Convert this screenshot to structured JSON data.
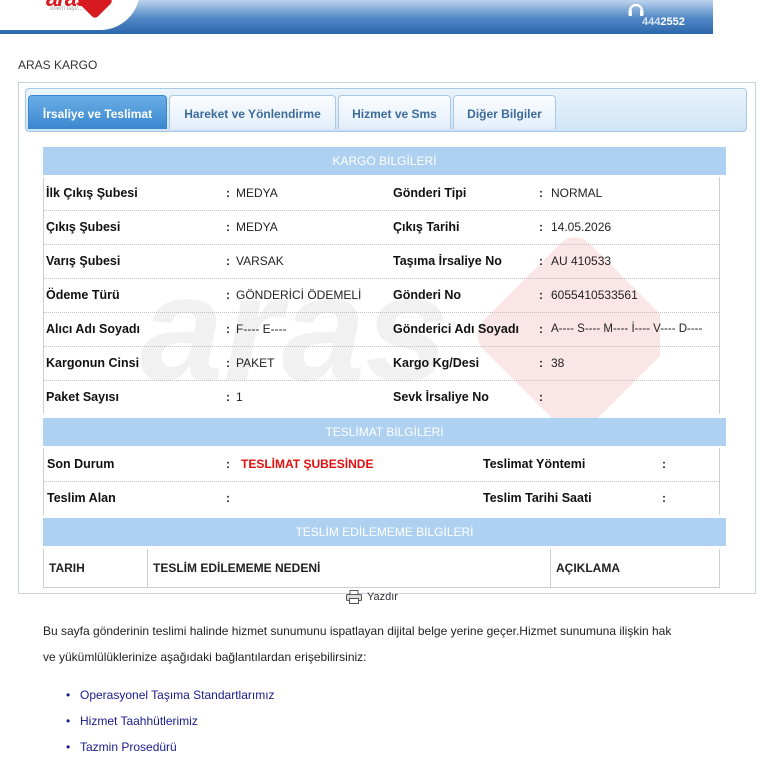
{
  "header": {
    "logo_text": "aras",
    "logo_tagline": "önem taşır...",
    "phone_prefix": "444",
    "phone_number": "2552"
  },
  "brand_label": "ARAS KARGO",
  "tabs": [
    {
      "label": "İrsaliye ve Teslimat",
      "active": true
    },
    {
      "label": "Hareket ve Yönlendirme",
      "active": false
    },
    {
      "label": "Hizmet ve Sms",
      "active": false
    },
    {
      "label": "Diğer Bilgiler",
      "active": false
    }
  ],
  "kargo": {
    "title": "KARGO BİLGİLERİ",
    "rows": [
      {
        "l1": "İlk Çıkış Şubesi",
        "v1": "MEDYA",
        "l2": "Gönderi Tipi",
        "v2": "NORMAL"
      },
      {
        "l1": "Çıkış Şubesi",
        "v1": "MEDYA",
        "l2": "Çıkış Tarihi",
        "v2": "14.05.2026"
      },
      {
        "l1": "Varış Şubesi",
        "v1": "VARSAK",
        "l2": "Taşıma İrsaliye No",
        "v2": "AU 410533"
      },
      {
        "l1": "Ödeme Türü",
        "v1": "GÖNDERİCİ ÖDEMELİ",
        "l2": "Gönderi No",
        "v2": "6055410533561"
      },
      {
        "l1": "Alıcı Adı Soyadı",
        "v1": "F---- E----",
        "l2": "Gönderici Adı Soyadı",
        "v2": "A---- S---- M---- İ---- V---- D----"
      },
      {
        "l1": "Kargonun Cinsi",
        "v1": "PAKET",
        "l2": "Kargo Kg/Desi",
        "v2": "38"
      },
      {
        "l1": "Paket Sayısı",
        "v1": "1",
        "l2": "Sevk İrsaliye No",
        "v2": ""
      }
    ]
  },
  "teslimat": {
    "title": "TESLİMAT BİLGİLERİ",
    "rows": [
      {
        "l1": "Son Durum",
        "v1": "TESLİMAT ŞUBESİNDE",
        "l2": "Teslimat Yöntemi",
        "v2": ""
      },
      {
        "l1": "Teslim Alan",
        "v1": "",
        "l2": "Teslim Tarihi Saati",
        "v2": ""
      }
    ]
  },
  "not_delivered": {
    "title": "TESLİM EDİLEMEME BİLGİLERİ",
    "columns": [
      "TARIH",
      "TESLİM EDİLEMEME NEDENİ",
      "AÇIKLAMA"
    ]
  },
  "print_label": "Yazdır",
  "info_text": "Bu sayfa gönderinin teslimi halinde hizmet sunumunu ispatlayan dijital belge yerine geçer.Hizmet sunumuna ilişkin hak ve yükümlülüklerinize aşağıdaki bağlantılardan erişebilirsiniz:",
  "links": [
    "Operasyonel Taşıma Standartlarımız",
    "Hizmet Taahhütlerimiz",
    "Tazmin Prosedürü"
  ],
  "colors": {
    "accent": "#3a86cf",
    "section": "#aed1f1",
    "alert": "#e01010",
    "link": "#1a1a8c"
  }
}
